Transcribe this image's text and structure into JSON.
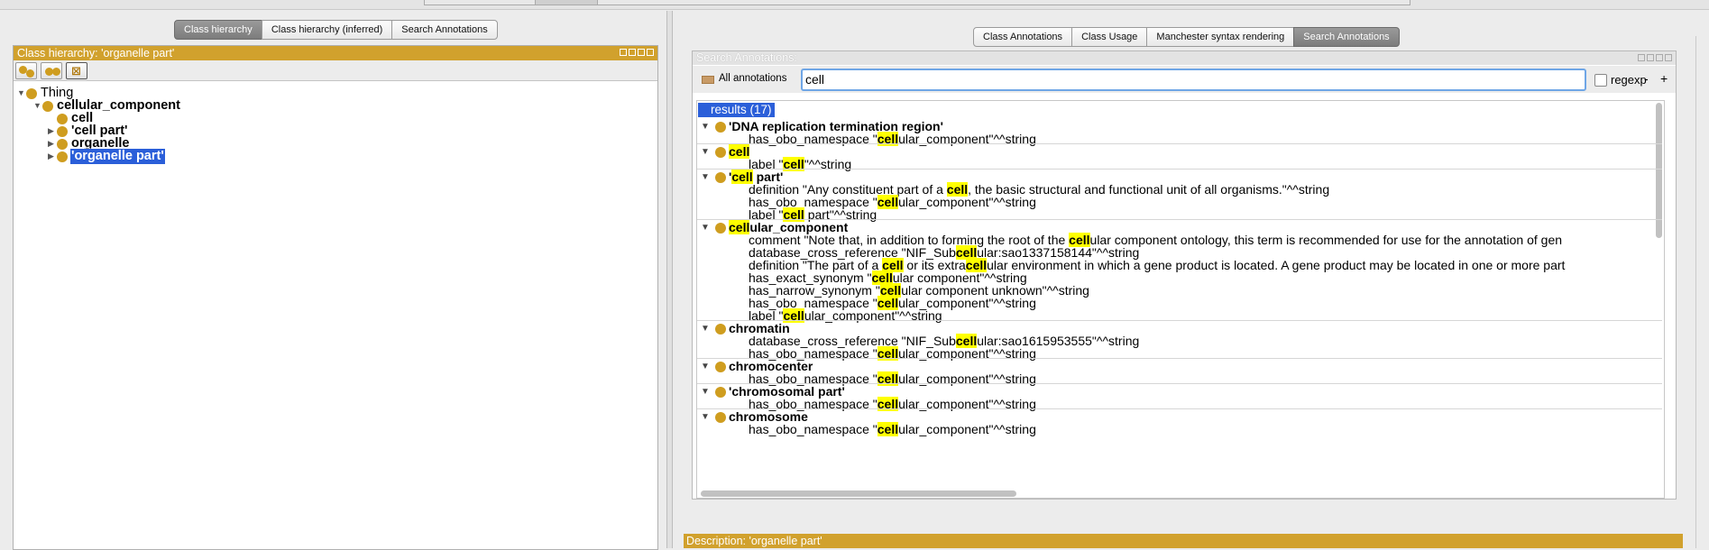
{
  "left": {
    "tabs": [
      "Class hierarchy",
      "Class hierarchy (inferred)",
      "Search Annotations"
    ],
    "active_tab": 0,
    "view_title": "Class hierarchy: 'organelle part'",
    "toolbar_icons": [
      "add-subclass-icon",
      "add-sibling-icon",
      "delete-class-icon"
    ],
    "tree": [
      {
        "label": "Thing",
        "depth": 0,
        "toggle": "down",
        "bold": false,
        "selected": false
      },
      {
        "label": "cellular_component",
        "depth": 1,
        "toggle": "down",
        "bold": true,
        "selected": false
      },
      {
        "label": "cell",
        "depth": 2,
        "toggle": "",
        "bold": true,
        "selected": false
      },
      {
        "label": "'cell part'",
        "depth": 2,
        "toggle": "right",
        "bold": true,
        "selected": false
      },
      {
        "label": "organelle",
        "depth": 2,
        "toggle": "right",
        "bold": true,
        "selected": false
      },
      {
        "label": "'organelle part'",
        "depth": 2,
        "toggle": "right",
        "bold": true,
        "selected": true
      }
    ]
  },
  "right": {
    "tabs": [
      "Class Annotations",
      "Class Usage",
      "Manchester syntax rendering",
      "Search Annotations"
    ],
    "active_tab": 3,
    "view_title": "Search Annotations:",
    "filter_label": "All annotations",
    "search_value": "cell",
    "regexp_label": "regexp",
    "minus_label": "-",
    "plus_label": "+",
    "results_header": "results (17)",
    "results": [
      {
        "name": "'DNA replication termination region'",
        "annotations": [
          [
            "has_obo_namespace \"",
            "cell",
            "ular_component\"^^string"
          ]
        ]
      },
      {
        "name": [
          "",
          "cell",
          ""
        ],
        "annotations": [
          [
            "label \"",
            "cell",
            "\"^^string"
          ]
        ]
      },
      {
        "name": [
          "'",
          "cell",
          " part'"
        ],
        "annotations": [
          [
            "definition \"Any constituent part of a ",
            "cell",
            ", the basic structural and functional unit of all organisms.\"^^string"
          ],
          [
            "has_obo_namespace \"",
            "cell",
            "ular_component\"^^string"
          ],
          [
            "label \"",
            "cell",
            " part\"^^string"
          ]
        ]
      },
      {
        "name": [
          "",
          "cell",
          "ular_component"
        ],
        "annotations": [
          [
            "comment \"Note that, in addition to forming the root of the ",
            "cell",
            "ular component ontology, this term is recommended for use for the annotation of gen"
          ],
          [
            "database_cross_reference \"NIF_Sub",
            "cell",
            "ular:sao1337158144\"^^string"
          ],
          [
            "definition \"The part of a ",
            "cell",
            " or its extra",
            "cell",
            "ular environment in which a gene product is located. A gene product may be located in one or more part"
          ],
          [
            "has_exact_synonym \"",
            "cell",
            "ular component\"^^string"
          ],
          [
            "has_narrow_synonym \"",
            "cell",
            "ular component unknown\"^^string"
          ],
          [
            "has_obo_namespace \"",
            "cell",
            "ular_component\"^^string"
          ],
          [
            "label \"",
            "cell",
            "ular_component\"^^string"
          ]
        ]
      },
      {
        "name": "chromatin",
        "annotations": [
          [
            "database_cross_reference \"NIF_Sub",
            "cell",
            "ular:sao1615953555\"^^string"
          ],
          [
            "has_obo_namespace \"",
            "cell",
            "ular_component\"^^string"
          ]
        ]
      },
      {
        "name": "chromocenter",
        "annotations": [
          [
            "has_obo_namespace \"",
            "cell",
            "ular_component\"^^string"
          ]
        ]
      },
      {
        "name": "'chromosomal part'",
        "annotations": [
          [
            "has_obo_namespace \"",
            "cell",
            "ular_component\"^^string"
          ]
        ]
      },
      {
        "name": "chromosome",
        "annotations": [
          [
            "has_obo_namespace \"",
            "cell",
            "ular_component\"^^string"
          ]
        ]
      }
    ],
    "description_title": "Description: 'organelle part'"
  },
  "colors": {
    "view_header": "#d1a12d",
    "class_bulb": "#cf9d1f",
    "selection": "#2b5fd9",
    "highlight": "#ffff00"
  }
}
